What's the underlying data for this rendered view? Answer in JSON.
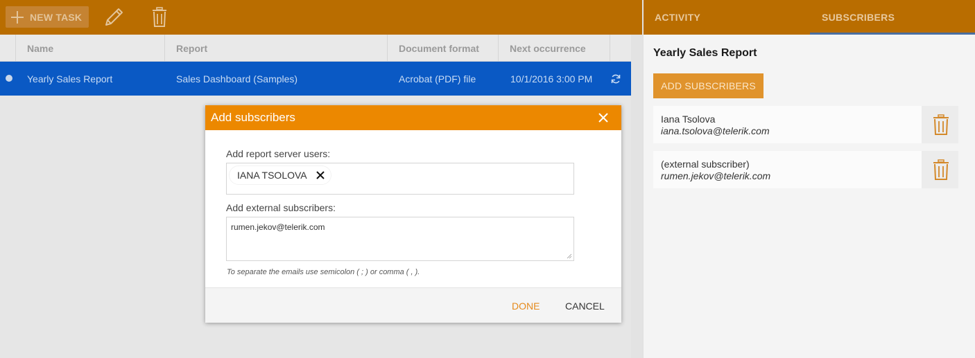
{
  "toolbar": {
    "new_task_label": "NEW TASK",
    "icons": [
      "plus-icon",
      "pencil-icon",
      "trash-icon"
    ]
  },
  "grid": {
    "columns": [
      "Name",
      "Report",
      "Document format",
      "Next occurrence"
    ],
    "rows": [
      {
        "name": "Yearly Sales Report",
        "report": "Sales Dashboard (Samples)",
        "format": "Acrobat (PDF) file",
        "next": "10/1/2016 3:00 PM"
      }
    ]
  },
  "right_panel": {
    "tabs": [
      "ACTIVITY",
      "SUBSCRIBERS"
    ],
    "active_tab": "SUBSCRIBERS",
    "title": "Yearly Sales Report",
    "add_button": "ADD SUBSCRIBERS",
    "subscribers": [
      {
        "name": "Iana Tsolova",
        "email": "iana.tsolova@telerik.com"
      },
      {
        "name": "(external subscriber)",
        "email": "rumen.jekov@telerik.com"
      }
    ]
  },
  "modal": {
    "title": "Add subscribers",
    "users_label": "Add report server users:",
    "selected_users": [
      "IANA TSOLOVA"
    ],
    "external_label": "Add external subscribers:",
    "external_value": "rumen.jekov@telerik.com",
    "hint": "To separate the emails use semicolon ( ; ) or comma ( , ).",
    "done": "DONE",
    "cancel": "CANCEL"
  },
  "colors": {
    "toolbar": "#b96d00",
    "modal_header": "#ec8800",
    "selected_row": "#0a59c4",
    "accent_button": "#e0932c",
    "trash_icon": "#d4892a"
  }
}
